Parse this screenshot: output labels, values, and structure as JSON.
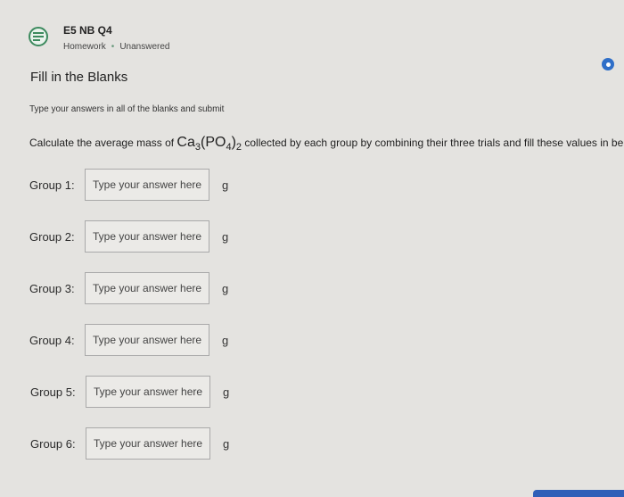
{
  "header": {
    "title": "E5 NB Q4",
    "category": "Homework",
    "status": "Unanswered",
    "icon": "list-check-icon",
    "accent_color": "#3c8a5e"
  },
  "info_icon": {
    "icon": "info-dot-icon",
    "color": "#2f6fc8"
  },
  "section_title": "Fill in the Blanks",
  "instructions": "Type your answers in all of the blanks and submit",
  "question": {
    "prefix": "Calculate the average mass of ",
    "formula_main": "Ca",
    "formula_sub1": "3",
    "formula_paren": "(PO",
    "formula_sub2": "4",
    "formula_close": ")",
    "formula_sub3": "2",
    "suffix": " collected by each group by combining their three trials and fill these values in below."
  },
  "groups": [
    {
      "label": "Group 1:",
      "placeholder": "Type your answer here",
      "value": "",
      "unit": "g"
    },
    {
      "label": "Group 2:",
      "placeholder": "Type your answer here",
      "value": "",
      "unit": "g"
    },
    {
      "label": "Group 3:",
      "placeholder": "Type your answer here",
      "value": "",
      "unit": "g"
    },
    {
      "label": "Group 4:",
      "placeholder": "Type your answer here",
      "value": "",
      "unit": "g"
    },
    {
      "label": "Group 5:",
      "placeholder": "Type your answer here",
      "value": "",
      "unit": "g"
    },
    {
      "label": "Group 6:",
      "placeholder": "Type your answer here",
      "value": "",
      "unit": "g"
    }
  ]
}
